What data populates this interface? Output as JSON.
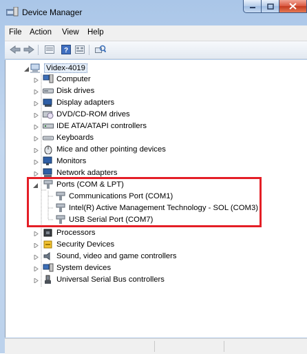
{
  "window": {
    "title": "Device Manager"
  },
  "menu": [
    "File",
    "Action",
    "View",
    "Help"
  ],
  "toolbar": [
    "back-icon",
    "forward-icon",
    "properties-icon",
    "help-icon",
    "view-icon",
    "scan-hardware-icon"
  ],
  "tree": {
    "root": "Videx-4019",
    "categories": [
      "Computer",
      "Disk drives",
      "Display adapters",
      "DVD/CD-ROM drives",
      "IDE ATA/ATAPI controllers",
      "Keyboards",
      "Mice and other pointing devices",
      "Monitors",
      "Network adapters",
      "Ports (COM & LPT)",
      "Processors",
      "Security Devices",
      "Sound, video and game controllers",
      "System devices",
      "Universal Serial Bus controllers"
    ],
    "ports_children": [
      "Communications Port (COM1)",
      "Intel(R) Active Management Technology - SOL (COM3)",
      "USB Serial Port (COM7)"
    ]
  },
  "colors": {
    "highlight": "#e41e26",
    "title_gradient_top": "#aac6e8",
    "close_button": "#c33a1f"
  }
}
